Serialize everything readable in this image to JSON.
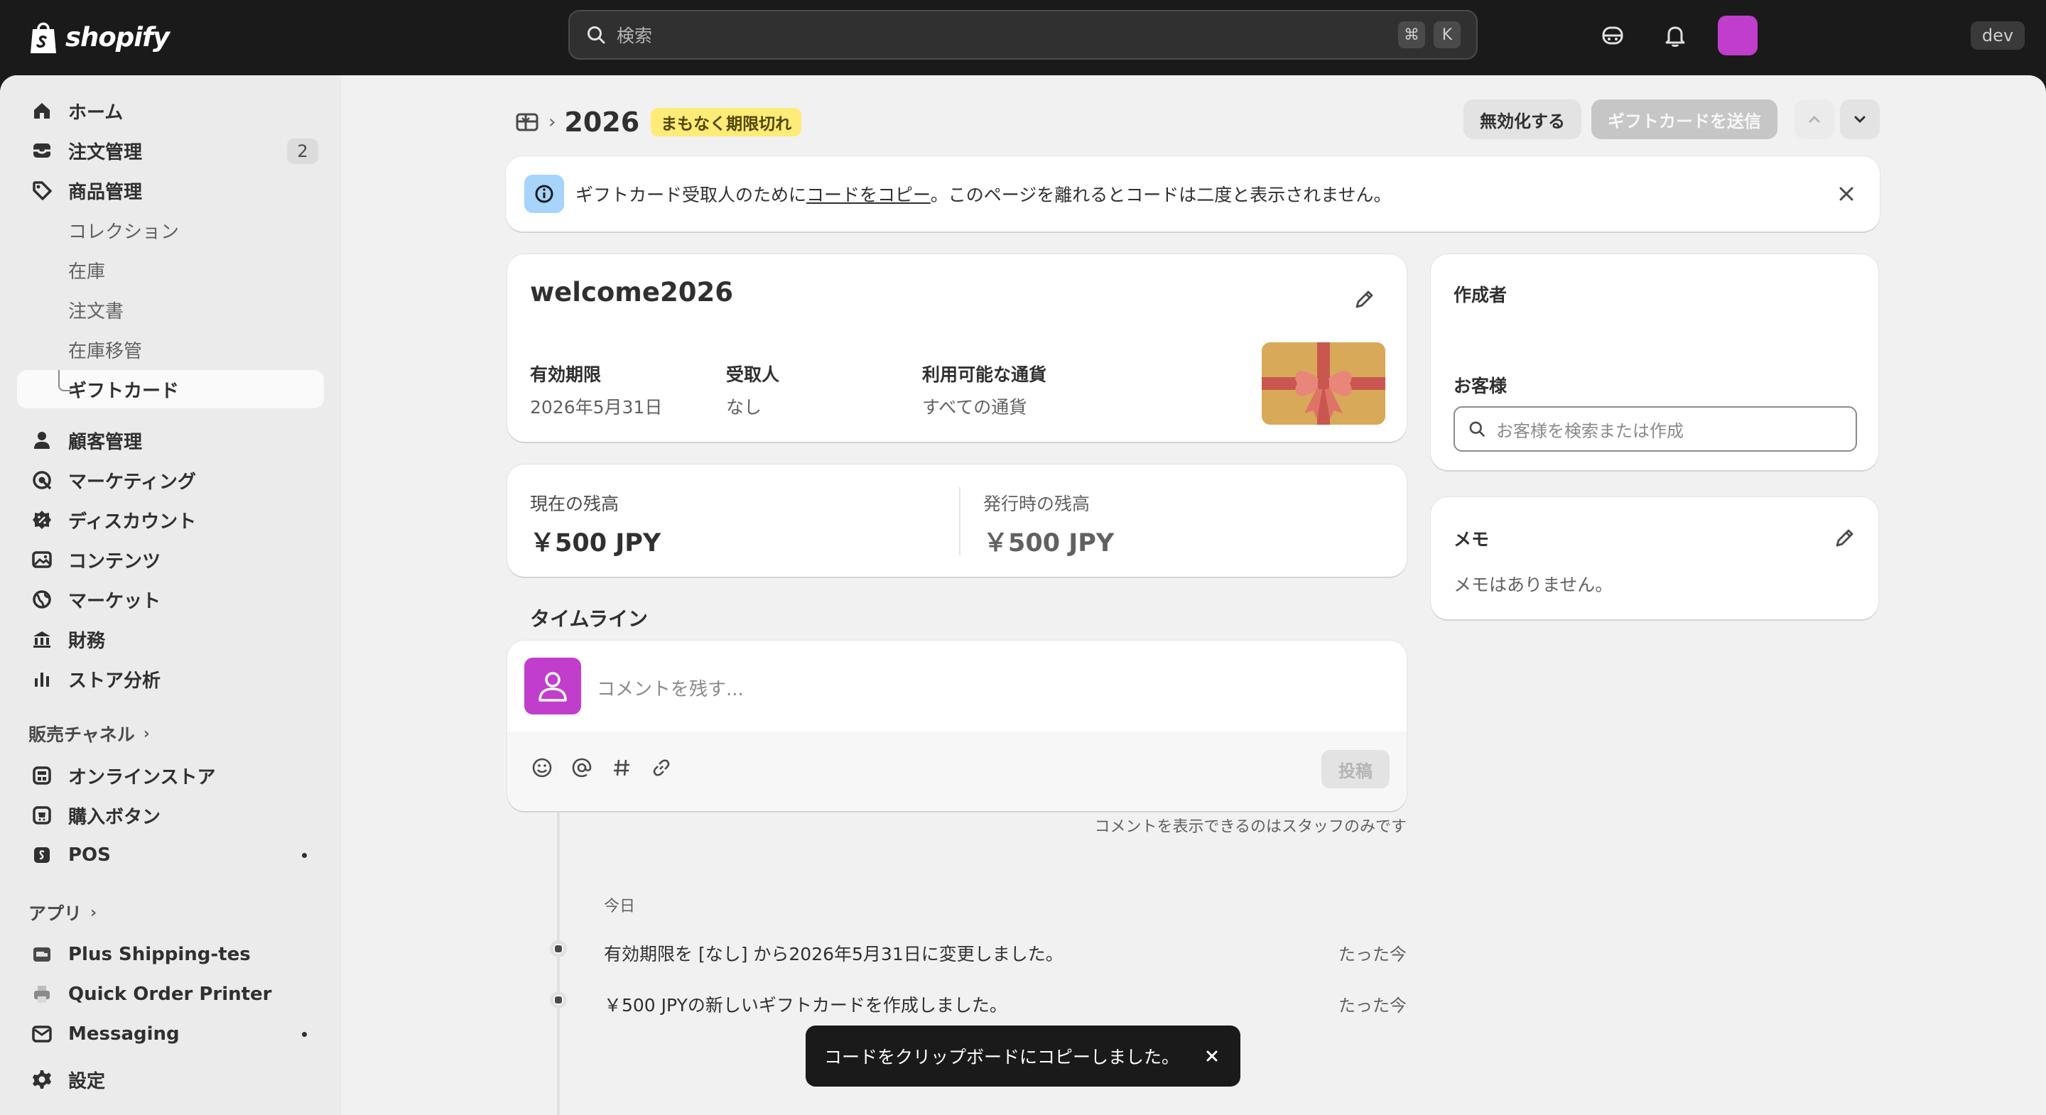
{
  "topbar": {
    "brand": "shopify",
    "search_placeholder": "検索",
    "kbd_cmd": "⌘",
    "kbd_k": "K",
    "dev_label": "dev",
    "avatar_color": "#c13dcc"
  },
  "sidebar": {
    "home": "ホーム",
    "orders": "注文管理",
    "orders_count": "2",
    "products": "商品管理",
    "collections": "コレクション",
    "inventory": "在庫",
    "purchase_orders": "注文書",
    "transfers": "在庫移管",
    "gift_cards": "ギフトカード",
    "customers": "顧客管理",
    "marketing": "マーケティング",
    "discounts": "ディスカウント",
    "content": "コンテンツ",
    "markets": "マーケット",
    "finance": "財務",
    "analytics": "ストア分析",
    "sales_channels": "販売チャネル",
    "online_store": "オンラインストア",
    "buy_button": "購入ボタン",
    "pos": "POS",
    "apps": "アプリ",
    "app1": "Plus Shipping-tes",
    "app2": "Quick Order Printer",
    "app3": "Messaging",
    "settings": "設定"
  },
  "header": {
    "title": "2026",
    "status_badge": "まもなく期限切れ",
    "deactivate_button": "無効化する",
    "send_button": "ギフトカードを送信"
  },
  "banner": {
    "text_before": "ギフトカード受取人のために",
    "link": "コードをコピー",
    "text_after": "。このページを離れるとコードは二度と表示されません。"
  },
  "giftcard": {
    "code": "welcome2026",
    "expiry_label": "有効期限",
    "expiry_value": "2026年5月31日",
    "recipient_label": "受取人",
    "recipient_value": "なし",
    "currency_label": "利用可能な通貨",
    "currency_value": "すべての通貨"
  },
  "balance": {
    "current_label": "現在の残高",
    "current_value": "￥500 JPY",
    "initial_label": "発行時の残高",
    "initial_value": "￥500 JPY"
  },
  "timeline": {
    "heading": "タイムライン",
    "comment_placeholder": "コメントを残す...",
    "post_button": "投稿",
    "staff_note": "コメントを表示できるのはスタッフのみです",
    "date_label": "今日",
    "events": [
      {
        "text": "有効期限を [なし] から2026年5月31日に変更しました。",
        "time": "たった今"
      },
      {
        "text": "￥500 JPYの新しいギフトカードを作成しました。",
        "time": "たった今"
      }
    ]
  },
  "side": {
    "creator_label": "作成者",
    "customer_label": "お客様",
    "customer_placeholder": "お客様を検索または作成",
    "notes_label": "メモ",
    "notes_empty": "メモはありません。"
  },
  "toast": {
    "text": "コードをクリップボードにコピーしました。"
  }
}
